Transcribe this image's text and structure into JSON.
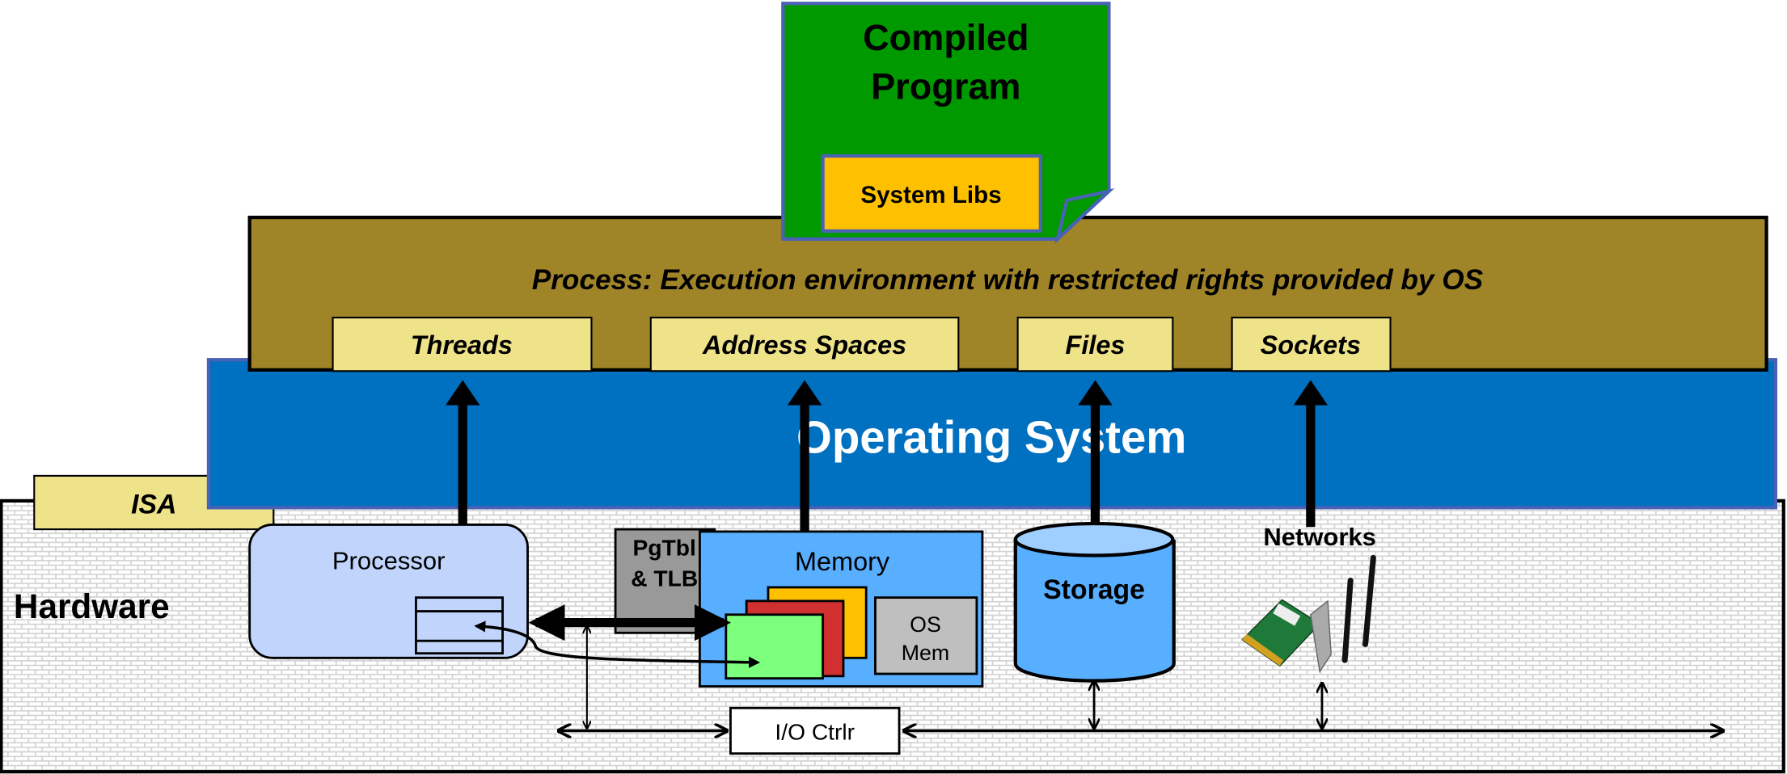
{
  "program": {
    "title_line1": "Compiled",
    "title_line2": "Program",
    "libs": "System Libs"
  },
  "process": {
    "title": "Process: Execution environment with restricted rights provided by OS",
    "tabs": [
      "Threads",
      "Address Spaces",
      "Files",
      "Sockets"
    ]
  },
  "os": {
    "label": "Operating System"
  },
  "isa": {
    "label": "ISA"
  },
  "hardware": {
    "label": "Hardware",
    "processor": "Processor",
    "pgtbl_line1": "PgTbl",
    "pgtbl_line2": "& TLB",
    "memory": "Memory",
    "osmem_line1": "OS",
    "osmem_line2": "Mem",
    "storage": "Storage",
    "networks": "Networks",
    "io_ctrl": "I/O Ctrlr"
  },
  "colors": {
    "program_green": "#009900",
    "libs_orange": "#FFC000",
    "process_olive": "#A08428",
    "tab_yellow": "#EFE38A",
    "os_blue": "#0070C0",
    "processor_fill": "#C0D4FC",
    "memory_fill": "#58AEFF",
    "storage_fill": "#58AEFF"
  }
}
